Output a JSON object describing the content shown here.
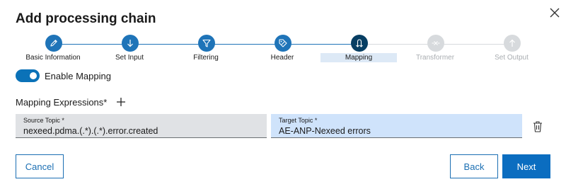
{
  "dialog": {
    "title": "Add processing chain"
  },
  "steps": [
    {
      "label": "Basic Information",
      "state": "done",
      "icon": "pencil-icon"
    },
    {
      "label": "Set Input",
      "state": "done",
      "icon": "arrow-down-icon"
    },
    {
      "label": "Filtering",
      "state": "done",
      "icon": "filter-icon"
    },
    {
      "label": "Header",
      "state": "done",
      "icon": "header-tag-icon"
    },
    {
      "label": "Mapping",
      "state": "active",
      "icon": "mapping-arrows-icon"
    },
    {
      "label": "Transformer",
      "state": "pending",
      "icon": "transform-icon"
    },
    {
      "label": "Set Output",
      "state": "pending",
      "icon": "arrow-up-icon"
    }
  ],
  "toggle": {
    "label": "Enable Mapping",
    "checked": true
  },
  "mapping": {
    "section_label": "Mapping Expressions*",
    "source": {
      "label": "Source Topic *",
      "value": "nexeed.pdma.(.*).(.*).error.created"
    },
    "target": {
      "label": "Target Topic *",
      "value": "AE-ANP-Nexeed errors"
    }
  },
  "buttons": {
    "cancel": "Cancel",
    "back": "Back",
    "next": "Next"
  },
  "colors": {
    "step_done": "#1f74b8",
    "step_active": "#073e63",
    "step_pending": "#d7dadd",
    "primary": "#0b6dc0",
    "target_field_bg": "#cfe3fb",
    "source_field_bg": "#e0e2e5"
  }
}
